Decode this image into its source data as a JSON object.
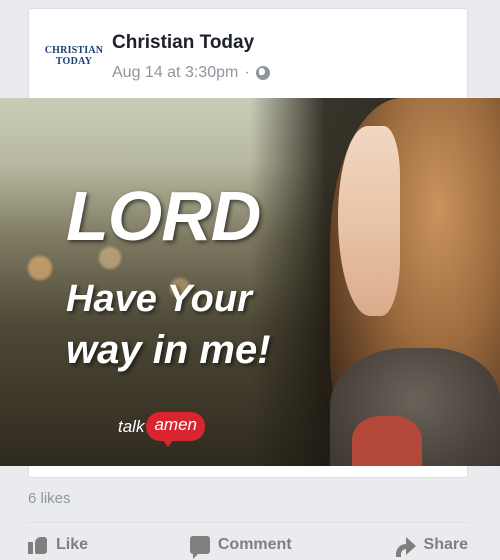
{
  "post": {
    "page_name": "Christian Today",
    "avatar_line1": "CHRISTIAN",
    "avatar_line2": "TODAY",
    "timestamp": "Aug 14 at 3:30pm",
    "separator": "·",
    "privacy_icon": "globe-icon"
  },
  "image": {
    "line1": "LORD",
    "line2": "Have Your",
    "line3": "way in me!",
    "logo_talk": "talk",
    "logo_amen": "amen"
  },
  "engagement": {
    "likes": "6 likes"
  },
  "actions": {
    "like": "Like",
    "comment": "Comment",
    "share": "Share"
  },
  "colors": {
    "background": "#e9ebee",
    "card": "#ffffff",
    "accent_red": "#d9262e",
    "meta_gray": "#90949c"
  }
}
